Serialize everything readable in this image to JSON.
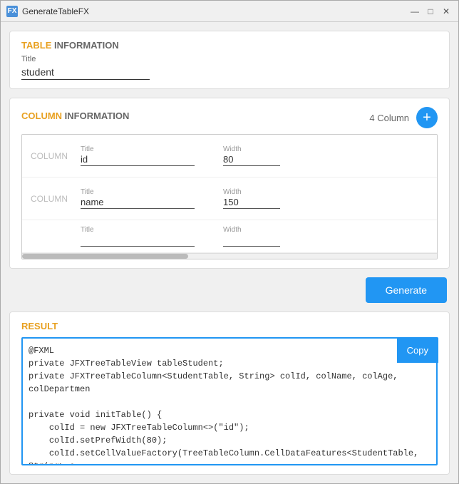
{
  "window": {
    "title": "GenerateTableFX",
    "icon_label": "FX"
  },
  "title_bar": {
    "minimize_label": "—",
    "maximize_label": "□",
    "close_label": "✕"
  },
  "table_info": {
    "section_title_highlight": "TABLE",
    "section_title_normal": " INFORMATION",
    "title_label": "Title",
    "title_value": "student"
  },
  "column_info": {
    "section_title_highlight": "COLUMN",
    "section_title_normal": " INFORMATION",
    "column_count_label": "4 Column",
    "add_button_label": "+",
    "columns": [
      {
        "label": "COLUMN",
        "title_label": "Title",
        "title_value": "id",
        "width_label": "Width",
        "width_value": "80"
      },
      {
        "label": "COLUMN",
        "title_label": "Title",
        "title_value": "name",
        "width_label": "Width",
        "width_value": "150"
      },
      {
        "label": "",
        "title_label": "Title",
        "title_value": "",
        "width_label": "Width",
        "width_value": ""
      }
    ]
  },
  "actions": {
    "generate_label": "Generate"
  },
  "result": {
    "section_title_highlight": "RESULT",
    "copy_label": "Copy",
    "code": "@FXML\nprivate JFXTreeTableView tableStudent;\nprivate JFXTreeTableColumn<StudentTable, String> colId, colName, colAge, colDepartmen\n\nprivate void initTable() {\n    colId = new JFXTreeTableColumn<>(\"id\");\n    colId.setPrefWidth(80);\n    colId.setCellValueFactory(TreeTableColumn.CellDataFeatures<StudentTable, String> c"
  }
}
